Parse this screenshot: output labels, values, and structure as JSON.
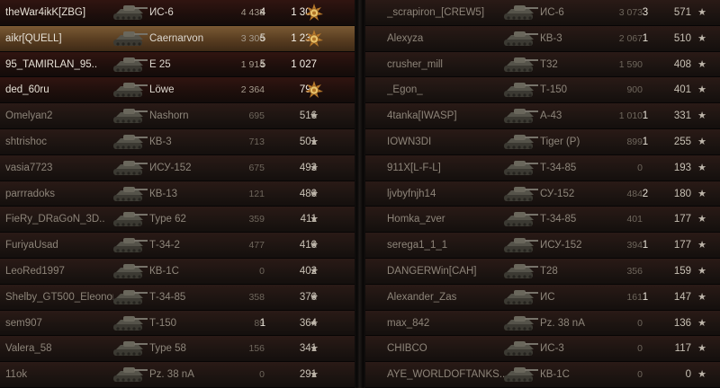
{
  "left_team": [
    {
      "player": "theWar4ikK[ZBG]",
      "tank": "ИС-6",
      "damage": "4 438",
      "frags": "4",
      "xp": "1 304",
      "medal": "ace-medal-icon",
      "state": "alive"
    },
    {
      "player": "aikr[QUELL]",
      "tank": "Caernarvon",
      "damage": "3 306",
      "frags": "5",
      "xp": "1 231",
      "medal": "ace-medal-icon",
      "state": "highlight"
    },
    {
      "player": "95_TAMIRLAN_95..",
      "tank": "E 25",
      "damage": "1 914",
      "frags": "5",
      "xp": "1 027",
      "medal": "",
      "state": "alive"
    },
    {
      "player": "ded_60ru",
      "tank": "Löwe",
      "damage": "2 364",
      "frags": "",
      "xp": "791",
      "medal": "ace-medal-icon",
      "state": "alive"
    },
    {
      "player": "Omelyan2",
      "tank": "Nashorn",
      "damage": "695",
      "frags": "",
      "xp": "516",
      "medal": "★",
      "state": "dead"
    },
    {
      "player": "shtrishoc",
      "tank": "КВ-3",
      "damage": "713",
      "frags": "",
      "xp": "501",
      "medal": "★",
      "state": "dead"
    },
    {
      "player": "vasia7723",
      "tank": "ИСУ-152",
      "damage": "675",
      "frags": "",
      "xp": "493",
      "medal": "★",
      "state": "dead"
    },
    {
      "player": "parrradoks",
      "tank": "КВ-13",
      "damage": "121",
      "frags": "",
      "xp": "480",
      "medal": "★",
      "state": "dead"
    },
    {
      "player": "FieRy_DRaGoN_3D..",
      "tank": "Type 62",
      "damage": "359",
      "frags": "",
      "xp": "411",
      "medal": "★",
      "state": "dead"
    },
    {
      "player": "FuriyaUsad",
      "tank": "Т-34-2",
      "damage": "477",
      "frags": "",
      "xp": "410",
      "medal": "★",
      "state": "dead"
    },
    {
      "player": "LeoRed1997",
      "tank": "КВ-1С",
      "damage": "0",
      "frags": "",
      "xp": "402",
      "medal": "★",
      "state": "dead"
    },
    {
      "player": "Shelby_GT500_Eleonor..",
      "tank": "Т-34-85",
      "damage": "358",
      "frags": "",
      "xp": "370",
      "medal": "★",
      "state": "dead"
    },
    {
      "player": "sem907",
      "tank": "Т-150",
      "damage": "89",
      "frags": "1",
      "xp": "364",
      "medal": "★",
      "state": "dead"
    },
    {
      "player": "Valera_58",
      "tank": "Type 58",
      "damage": "156",
      "frags": "",
      "xp": "341",
      "medal": "★",
      "state": "dead"
    },
    {
      "player": "11ok",
      "tank": "Pz. 38 nA",
      "damage": "0",
      "frags": "",
      "xp": "291",
      "medal": "★",
      "state": "dead"
    }
  ],
  "right_team": [
    {
      "player": "_scrapiron_[CREW5]",
      "tank": "ИС-6",
      "damage": "3 073",
      "frags": "3",
      "xp": "571",
      "medal": "★",
      "state": "dead"
    },
    {
      "player": "Alexyza",
      "tank": "КВ-3",
      "damage": "2 067",
      "frags": "1",
      "xp": "510",
      "medal": "★",
      "state": "dead"
    },
    {
      "player": "crusher_mill",
      "tank": "T32",
      "damage": "1 590",
      "frags": "",
      "xp": "408",
      "medal": "★",
      "state": "dead"
    },
    {
      "player": "_Egon_",
      "tank": "Т-150",
      "damage": "900",
      "frags": "",
      "xp": "401",
      "medal": "★",
      "state": "dead"
    },
    {
      "player": "4tanka[IWASP]",
      "tank": "А-43",
      "damage": "1 010",
      "frags": "1",
      "xp": "331",
      "medal": "★",
      "state": "dead"
    },
    {
      "player": "IOWN3DI",
      "tank": "Tiger (P)",
      "damage": "899",
      "frags": "1",
      "xp": "255",
      "medal": "★",
      "state": "dead"
    },
    {
      "player": "911X[L-F-L]",
      "tank": "Т-34-85",
      "damage": "0",
      "frags": "",
      "xp": "193",
      "medal": "★",
      "state": "dead"
    },
    {
      "player": "ljvbyfnjh14",
      "tank": "СУ-152",
      "damage": "484",
      "frags": "2",
      "xp": "180",
      "medal": "★",
      "state": "dead"
    },
    {
      "player": "Homka_zver",
      "tank": "Т-34-85",
      "damage": "401",
      "frags": "",
      "xp": "177",
      "medal": "★",
      "state": "dead"
    },
    {
      "player": "serega1_1_1",
      "tank": "ИСУ-152",
      "damage": "394",
      "frags": "1",
      "xp": "177",
      "medal": "★",
      "state": "dead"
    },
    {
      "player": "DANGERWin[CAH]",
      "tank": "T28",
      "damage": "356",
      "frags": "",
      "xp": "159",
      "medal": "★",
      "state": "dead"
    },
    {
      "player": "Alexander_Zas",
      "tank": "ИС",
      "damage": "161",
      "frags": "1",
      "xp": "147",
      "medal": "★",
      "state": "dead"
    },
    {
      "player": "max_842",
      "tank": "Pz. 38 nA",
      "damage": "0",
      "frags": "",
      "xp": "136",
      "medal": "★",
      "state": "dead"
    },
    {
      "player": "CHIBCO",
      "tank": "ИС-3",
      "damage": "0",
      "frags": "",
      "xp": "117",
      "medal": "★",
      "state": "dead"
    },
    {
      "player": "AYE_WORLDOFTANKS..",
      "tank": "КВ-1С",
      "damage": "0",
      "frags": "",
      "xp": "0",
      "medal": "★",
      "state": "dead"
    }
  ],
  "colors": {
    "alive_row": "#3a1a14",
    "highlight_row": "#6b4a2a",
    "dead_row": "#1f1512",
    "text_bright": "#e6e1d6",
    "text_dim": "#8d8479"
  }
}
